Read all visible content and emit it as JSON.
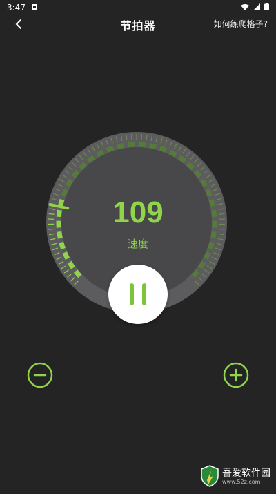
{
  "status_bar": {
    "time": "3:47"
  },
  "toolbar": {
    "title": "节拍器",
    "help_link": "如何练爬格子?"
  },
  "dial": {
    "tempo": "109",
    "tempo_label": "速度",
    "progress_fraction": 0.21
  },
  "colors": {
    "accent": "#8fd44a",
    "background": "#242424",
    "dial_face": "#4a4a4c"
  },
  "watermark": {
    "title": "吾爱软件园",
    "url": "www.52z.com"
  }
}
